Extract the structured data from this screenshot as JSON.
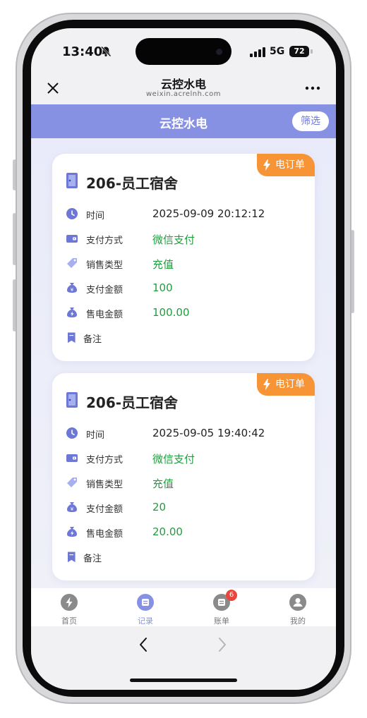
{
  "status": {
    "time": "13:40",
    "network": "5G",
    "battery": "72"
  },
  "nav": {
    "title": "云控水电",
    "domain": "weixin.acrelnh.com"
  },
  "appbar": {
    "title": "云控水电",
    "filter_label": "筛选"
  },
  "labels": {
    "time": "时间",
    "pay_method": "支付方式",
    "sale_type": "销售类型",
    "pay_amount": "支付金额",
    "sale_amount": "售电金额",
    "remark": "备注"
  },
  "orders": [
    {
      "tag": "电订单",
      "title": "206-员工宿舍",
      "time": "2025-09-09 20:12:12",
      "pay_method": "微信支付",
      "sale_type": "充值",
      "pay_amount": "100",
      "sale_amount": "100.00",
      "remark": ""
    },
    {
      "tag": "电订单",
      "title": "206-员工宿舍",
      "time": "2025-09-05 19:40:42",
      "pay_method": "微信支付",
      "sale_type": "充值",
      "pay_amount": "20",
      "sale_amount": "20.00",
      "remark": ""
    }
  ],
  "tabbar": {
    "items": [
      {
        "label": "首页",
        "icon": "lightning-icon"
      },
      {
        "label": "记录",
        "icon": "record-icon"
      },
      {
        "label": "账单",
        "icon": "bill-icon",
        "badge": "6"
      },
      {
        "label": "我的",
        "icon": "user-icon"
      }
    ],
    "active_index": 1
  },
  "colors": {
    "accent": "#8791e4",
    "tag": "#f79436",
    "green": "#1f9e3d"
  }
}
